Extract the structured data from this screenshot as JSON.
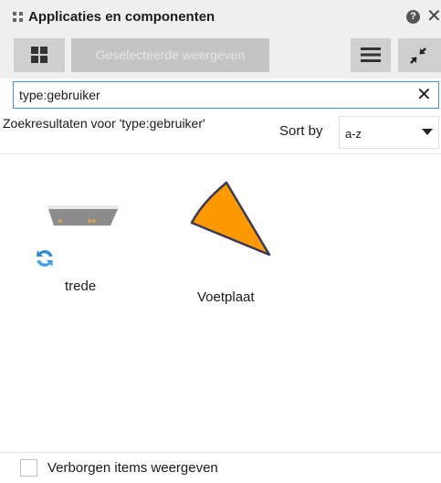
{
  "window": {
    "title": "Applicaties en componenten",
    "grip_icon": "grip-icon",
    "help_icon": "help-icon",
    "help_glyph": "?",
    "close_icon": "close-icon",
    "close_glyph": "✕"
  },
  "toolbar": {
    "tiles_icon": "tiles-view-icon",
    "show_selected_label": "Geselecteerde weergeven",
    "list_icon": "list-view-icon",
    "collapse_icon": "collapse-icon"
  },
  "search": {
    "value": "type:gebruiker",
    "clear_icon": "clear-icon",
    "clear_glyph": "✕"
  },
  "results": {
    "header": "Zoekresultaten voor 'type:gebruiker'",
    "sort_label": "Sort by",
    "sort_value": "a-z",
    "items": [
      {
        "label": "trede",
        "icon": "stair-tread-icon",
        "badge_icon": "sync-icon"
      },
      {
        "label": "Voetplaat",
        "icon": "base-plate-icon"
      }
    ]
  },
  "footer": {
    "hidden_items_label": "Verborgen items weergeven",
    "hidden_items_checked": false
  },
  "colors": {
    "accent": "#4a90d9",
    "voetplaat_fill": "#ff9900",
    "sync_blue": "#2a8ad6"
  }
}
